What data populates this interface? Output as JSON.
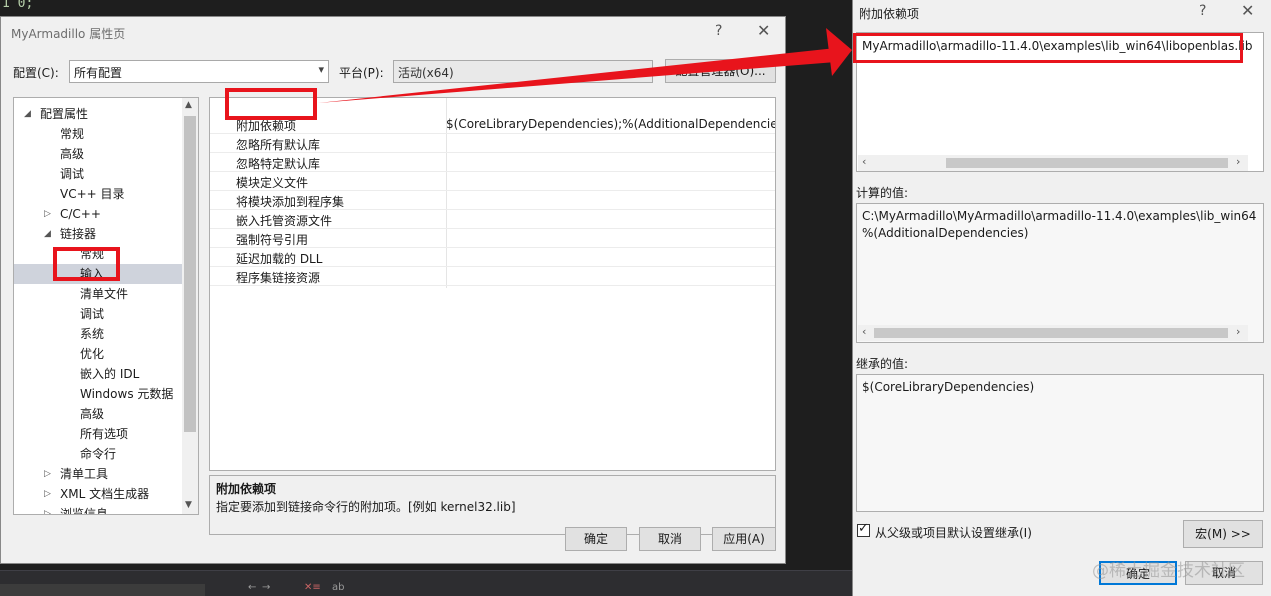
{
  "ide": {
    "code_text": "1 0;"
  },
  "prop_dialog": {
    "title": "MyArmadillo 属性页",
    "help": "?",
    "close": "✕",
    "config_label": "配置(C):",
    "config_value": "所有配置",
    "platform_label": "平台(P):",
    "platform_value": "活动(x64)",
    "config_manager": "配置管理器(O)...",
    "tree": [
      {
        "label": "配置属性",
        "caret": "◢"
      },
      {
        "label": "常规"
      },
      {
        "label": "高级"
      },
      {
        "label": "调试"
      },
      {
        "label": "VC++ 目录"
      },
      {
        "label": "C/C++",
        "caret": "▷"
      },
      {
        "label": "链接器",
        "caret": "◢"
      },
      {
        "label": "常规"
      },
      {
        "label": "输入"
      },
      {
        "label": "清单文件"
      },
      {
        "label": "调试"
      },
      {
        "label": "系统"
      },
      {
        "label": "优化"
      },
      {
        "label": "嵌入的 IDL"
      },
      {
        "label": "Windows 元数据"
      },
      {
        "label": "高级"
      },
      {
        "label": "所有选项"
      },
      {
        "label": "命令行"
      },
      {
        "label": "清单工具",
        "caret": "▷"
      },
      {
        "label": "XML 文档生成器",
        "caret": "▷"
      },
      {
        "label": "浏览信息",
        "caret": "▷"
      }
    ],
    "grid": [
      {
        "name": "附加依赖项",
        "value": "$(CoreLibraryDependencies);%(AdditionalDependencies"
      },
      {
        "name": "忽略所有默认库",
        "value": ""
      },
      {
        "name": "忽略特定默认库",
        "value": ""
      },
      {
        "name": "模块定义文件",
        "value": ""
      },
      {
        "name": "将模块添加到程序集",
        "value": ""
      },
      {
        "name": "嵌入托管资源文件",
        "value": ""
      },
      {
        "name": "强制符号引用",
        "value": ""
      },
      {
        "name": "延迟加载的 DLL",
        "value": ""
      },
      {
        "name": "程序集链接资源",
        "value": ""
      }
    ],
    "desc_title": "附加依赖项",
    "desc_text": "指定要添加到链接命令行的附加项。[例如 kernel32.lib]",
    "ok": "确定",
    "cancel": "取消",
    "apply": "应用(A)"
  },
  "dep_dialog": {
    "title": "附加依赖项",
    "help": "?",
    "close": "✕",
    "input_value": "MyArmadillo\\armadillo-11.4.0\\examples\\lib_win64\\libopenblas.lib",
    "computed_label": "计算的值:",
    "computed_line1": "C:\\MyArmadillo\\MyArmadillo\\armadillo-11.4.0\\examples\\lib_win64",
    "computed_line2": "%(AdditionalDependencies)",
    "inherited_label": "继承的值:",
    "inherited_value": "$(CoreLibraryDependencies)",
    "inherit_checkbox": "从父级或项目默认设置继承(I)",
    "macros": "宏(M) >>",
    "ok": "确定",
    "cancel": "取消"
  },
  "watermark": "@稀土掘金技术社区",
  "colors": {
    "annotation_red": "#e8141c",
    "dialog_bg": "#f0f0f0",
    "ide_bg": "#1e1e1e"
  }
}
